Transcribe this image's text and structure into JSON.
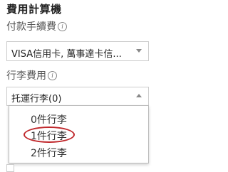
{
  "title": "費用計算機",
  "payment_fee": {
    "label": "付款手續費",
    "info_icon": "i",
    "selected": "VISA信用卡, 萬事達卡信..."
  },
  "baggage_fee": {
    "label": "行李費用",
    "info_icon": "i",
    "selected": "托運行李(0)"
  },
  "baggage_options": [
    "0件行李",
    "1件行李",
    "2件行李"
  ],
  "highlighted_option_index": 1,
  "colors": {
    "highlight_ring": "#c0282c",
    "border": "#cccccc"
  }
}
